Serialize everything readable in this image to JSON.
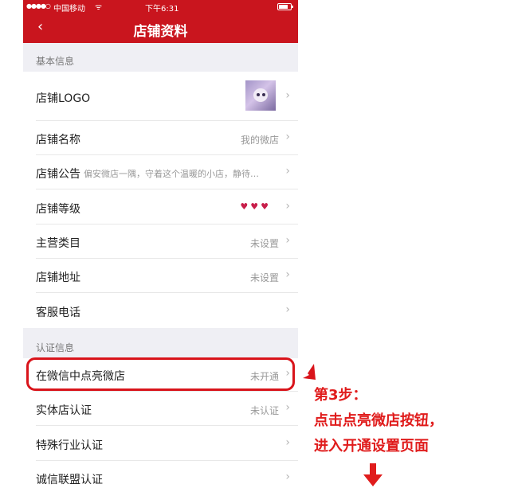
{
  "status_bar": {
    "signal": "●●●●○",
    "carrier": "中国移动",
    "wifi": "ᯤ",
    "time": "下午6:31"
  },
  "nav": {
    "back": "‹",
    "title": "店铺资料"
  },
  "sections": {
    "basic": "基本信息",
    "auth": "认证信息"
  },
  "rows": {
    "logo": {
      "label": "店铺LOGO"
    },
    "name": {
      "label": "店铺名称",
      "value": "我的微店"
    },
    "notice": {
      "label": "店铺公告",
      "value": "偏安微店一隅，守着这个温暖的小店，静待…"
    },
    "level": {
      "label": "店铺等级",
      "hearts": "♥♥♥"
    },
    "category": {
      "label": "主营类目",
      "value": "未设置"
    },
    "address": {
      "label": "店铺地址",
      "value": "未设置"
    },
    "service": {
      "label": "客服电话"
    },
    "wechat": {
      "label": "在微信中点亮微店",
      "value": "未开通"
    },
    "store_cert": {
      "label": "实体店认证",
      "value": "未认证"
    },
    "industry_cert": {
      "label": "特殊行业认证"
    },
    "alliance_cert": {
      "label": "诚信联盟认证"
    }
  },
  "chevron": "›",
  "annotation": {
    "line1": "第3步：",
    "line2": "点击点亮微店按钮，",
    "line3": "进入开通设置页面"
  },
  "colors": {
    "brand_red": "#c9151e",
    "annotation_red": "#e01c1c"
  },
  "icons": [
    "back-icon",
    "chevron-right-icon",
    "heart-icon",
    "arrow-pointer-icon",
    "arrow-down-icon"
  ]
}
